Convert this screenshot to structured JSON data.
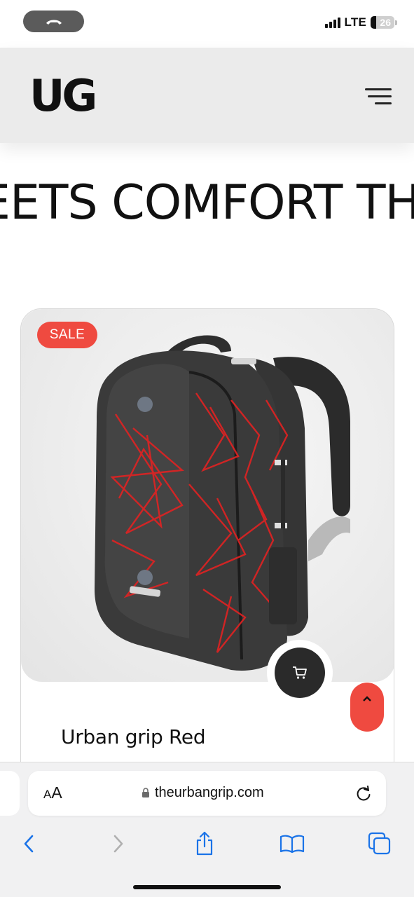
{
  "status_bar": {
    "network": "LTE",
    "battery": "26",
    "call_icon": "phone-hangup-icon"
  },
  "header": {
    "logo": "UG",
    "menu_icon": "hamburger-menu-icon"
  },
  "marquee": {
    "text": "EETS COMFORT TH"
  },
  "product": {
    "badge": "SALE",
    "title": "Urban grip Red",
    "image_alt": "black backpack with red geometric pattern",
    "cart_icon": "cart-icon",
    "accent_color": "#ef4a40"
  },
  "scroll_top": {
    "icon": "chevron-up-icon"
  },
  "browser": {
    "text_size_label_small": "A",
    "text_size_label_big": "A",
    "url": "theurbangrip.com",
    "lock_icon": "lock-icon",
    "reload_icon": "reload-icon",
    "toolbar": [
      "back-icon",
      "forward-icon",
      "share-icon",
      "bookmarks-icon",
      "tabs-icon"
    ]
  }
}
